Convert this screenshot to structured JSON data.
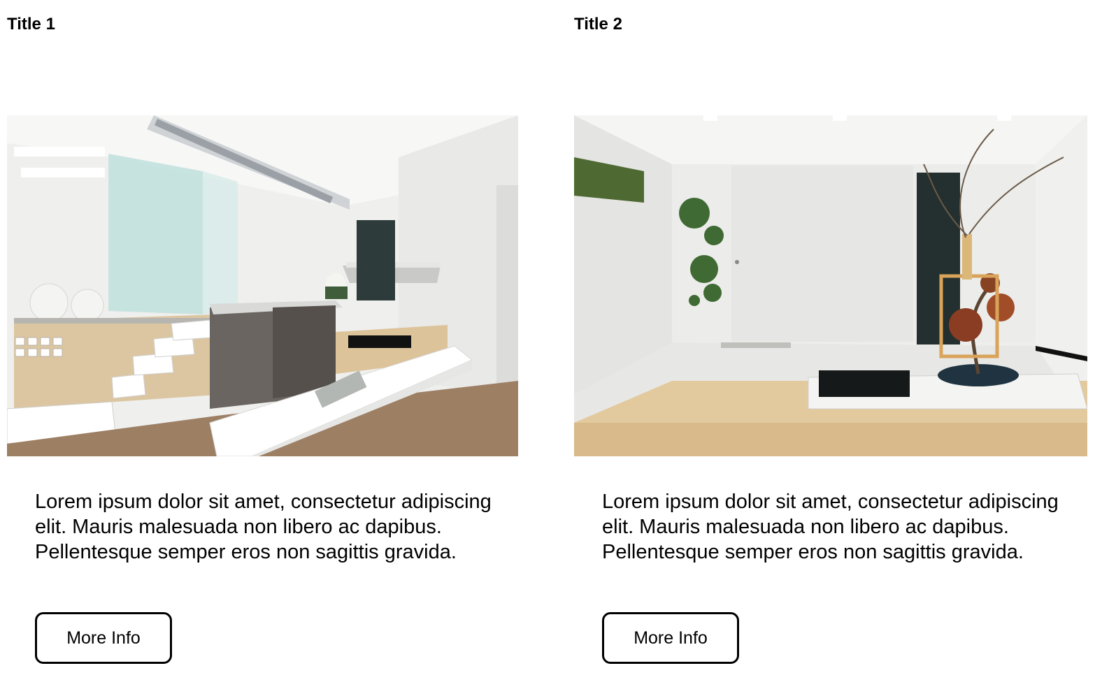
{
  "cards": [
    {
      "title": "Title 1",
      "image_alt": "kitchen-interior-photo",
      "text": "Lorem ipsum dolor sit amet, consectetur adipiscing elit. Mauris malesuada non libero ac dapibus. Pellentesque semper eros non sagittis gravida.",
      "button_label": "More Info"
    },
    {
      "title": "Title 2",
      "image_alt": "zen-room-interior-photo",
      "text": "Lorem ipsum dolor sit amet, consectetur adipiscing elit. Mauris malesuada non libero ac dapibus. Pellentesque semper eros non sagittis gravida.",
      "button_label": "More Info"
    }
  ]
}
